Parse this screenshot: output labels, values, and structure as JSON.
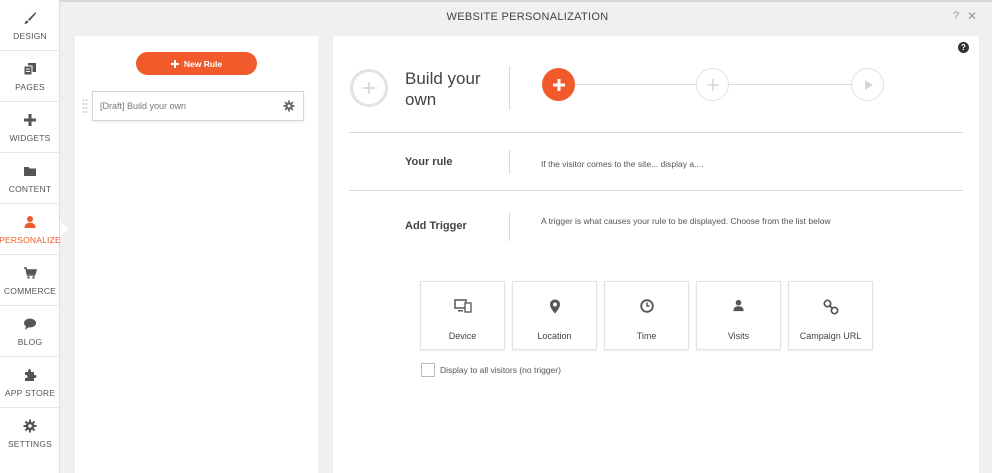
{
  "header": {
    "title": "WEBSITE PERSONALIZATION",
    "help": "?",
    "close": "✕"
  },
  "sidebar": {
    "accent": "#f15a2b",
    "items": [
      {
        "label": "DESIGN",
        "icon": "brush-icon"
      },
      {
        "label": "PAGES",
        "icon": "pages-icon"
      },
      {
        "label": "WIDGETS",
        "icon": "plus-icon"
      },
      {
        "label": "CONTENT",
        "icon": "folder-icon"
      },
      {
        "label": "PERSONALIZE",
        "icon": "person-icon"
      },
      {
        "label": "COMMERCE",
        "icon": "cart-icon"
      },
      {
        "label": "BLOG",
        "icon": "speech-bubble-icon"
      },
      {
        "label": "APP STORE",
        "icon": "puzzle-icon"
      },
      {
        "label": "SETTINGS",
        "icon": "gear-icon"
      }
    ]
  },
  "rules": {
    "new_rule_label": "New Rule",
    "items": [
      {
        "name": "[Draft] Build your own"
      }
    ]
  },
  "main": {
    "help_icon": "?",
    "title": "Build your own",
    "your_rule_label": "Your rule",
    "your_rule_text": "If the visitor comes to the site... display a....",
    "add_trigger_label": "Add Trigger",
    "add_trigger_text": "A trigger is what causes your rule to be displayed. Choose from the list below",
    "triggers": [
      {
        "label": "Device",
        "icon": "device-icon"
      },
      {
        "label": "Location",
        "icon": "location-pin-icon"
      },
      {
        "label": "Time",
        "icon": "clock-icon"
      },
      {
        "label": "Visits",
        "icon": "person-icon"
      },
      {
        "label": "Campaign URL",
        "icon": "link-icon"
      }
    ],
    "all_visitors_label": "Display to all visitors (no trigger)",
    "all_visitors_checked": false
  }
}
